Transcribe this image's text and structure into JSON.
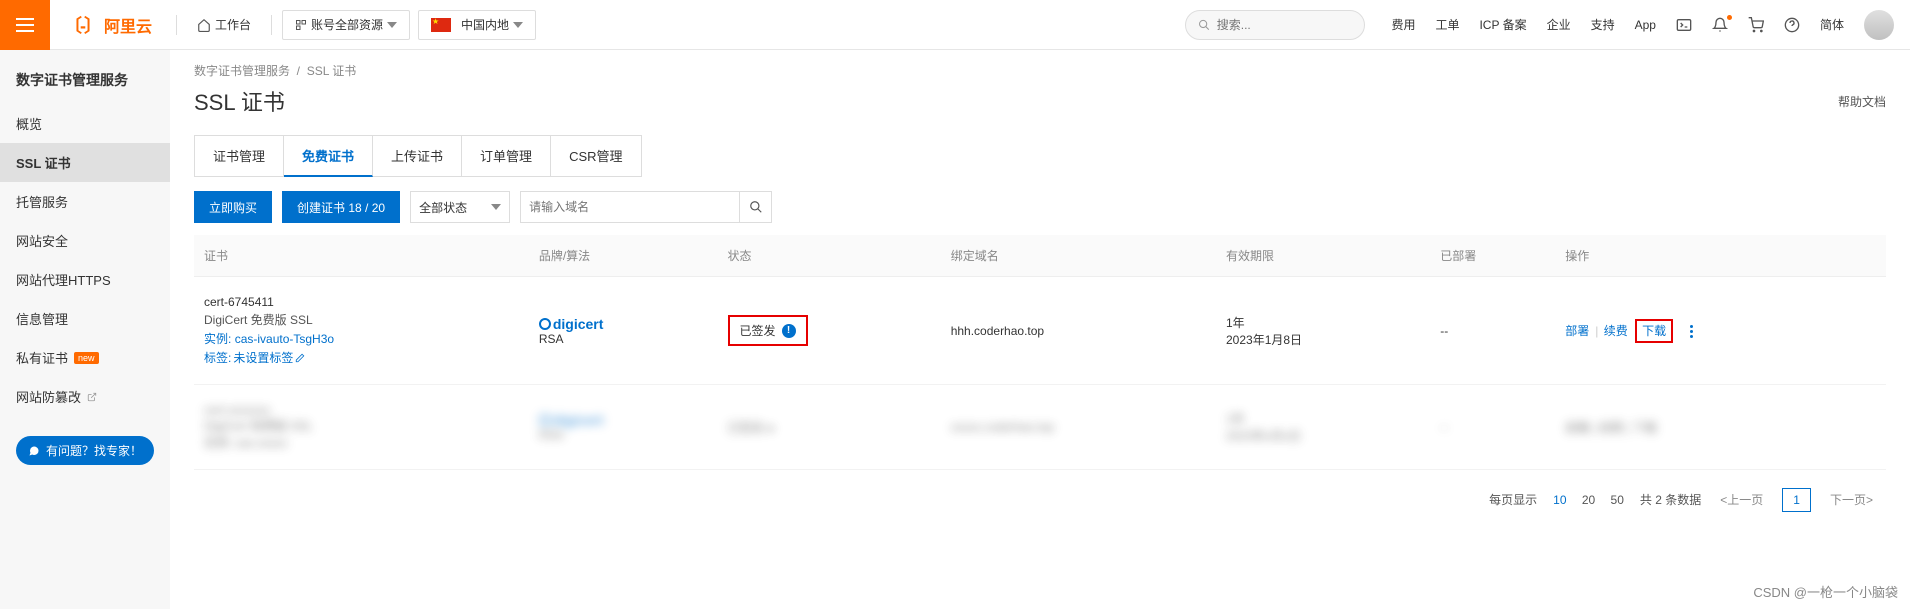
{
  "header": {
    "brand": "阿里云",
    "workspace": "工作台",
    "account_scope": "账号全部资源",
    "region": "中国内地",
    "search_placeholder": "搜索...",
    "links": {
      "fees": "费用",
      "orders": "工单",
      "icp": "ICP 备案",
      "enterprise": "企业",
      "support": "支持",
      "app": "App",
      "lang": "简体"
    }
  },
  "sidebar": {
    "title": "数字证书管理服务",
    "items": [
      {
        "label": "概览"
      },
      {
        "label": "SSL 证书",
        "active": true
      },
      {
        "label": "托管服务"
      },
      {
        "label": "网站安全"
      },
      {
        "label": "网站代理HTTPS"
      },
      {
        "label": "信息管理"
      },
      {
        "label": "私有证书",
        "badge": "new"
      },
      {
        "label": "网站防篡改",
        "external": true
      }
    ],
    "consult": "有问题？找专家！"
  },
  "breadcrumb": {
    "root": "数字证书管理服务",
    "leaf": "SSL 证书"
  },
  "page": {
    "title": "SSL 证书",
    "help": "帮助文档"
  },
  "tabs": [
    {
      "label": "证书管理"
    },
    {
      "label": "免费证书",
      "active": true
    },
    {
      "label": "上传证书"
    },
    {
      "label": "订单管理"
    },
    {
      "label": "CSR管理"
    }
  ],
  "toolbar": {
    "buy": "立即购买",
    "create": "创建证书 18 / 20",
    "status_filter": "全部状态",
    "domain_placeholder": "请输入域名"
  },
  "table": {
    "headers": {
      "cert": "证书",
      "brand": "品牌/算法",
      "status": "状态",
      "domain": "绑定域名",
      "validity": "有效期限",
      "deployed": "已部署",
      "ops": "操作"
    },
    "row": {
      "name": "cert-6745411",
      "type": "DigiCert 免费版 SSL",
      "instance_prefix": "实例:",
      "instance": "cas-ivauto-TsgH3o",
      "tags_prefix": "标签:",
      "tags": "未设置标签",
      "brand_name": "digicert",
      "algo": "RSA",
      "status": "已签发",
      "domain": "hhh.coderhao.top",
      "validity_term": "1年",
      "validity_date": "2023年1月8日",
      "deployed": "--",
      "op_deploy": "部署",
      "op_renew": "续费",
      "op_download": "下载"
    }
  },
  "pager": {
    "per_page_label": "每页显示",
    "sizes": [
      "10",
      "20",
      "50"
    ],
    "total": "共 2 条数据",
    "prev": "上一页",
    "page": "1",
    "next": "下一页"
  },
  "watermark": "CSDN @一枪一个小脑袋"
}
